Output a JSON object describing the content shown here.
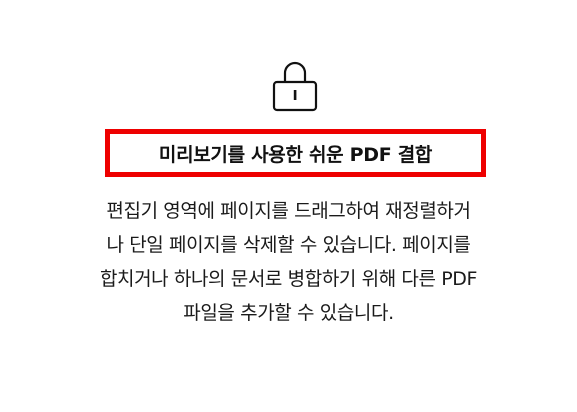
{
  "feature": {
    "icon": "lock-icon",
    "title": "미리보기를 사용한 쉬운 PDF 결합",
    "highlight_color": "#ee0000",
    "description_lines": [
      "편집기 영역에 페이지를 드래그하여 재정렬하거",
      "나 단일 페이지를 삭제할 수 있습니다. 페이지를",
      "합치거나 하나의 문서로 병합하기 위해 다른 PDF",
      "파일을 추가할 수 있습니다."
    ]
  }
}
